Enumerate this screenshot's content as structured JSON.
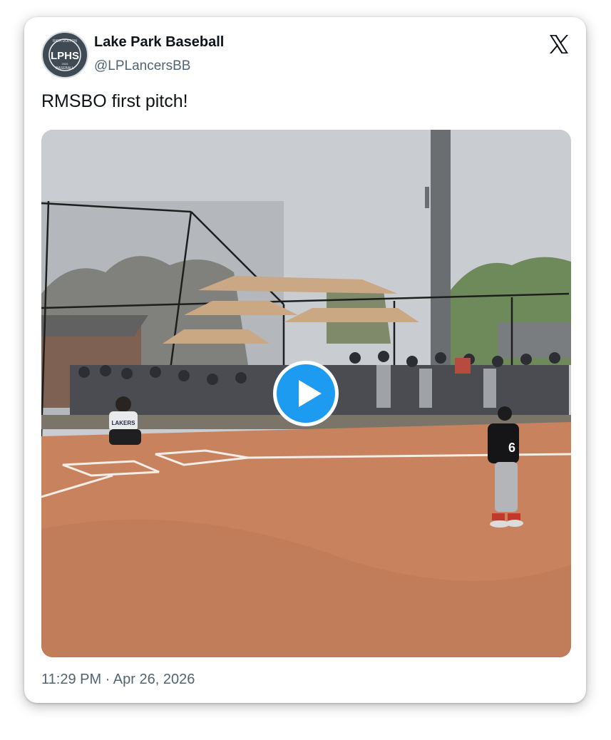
{
  "tweet": {
    "author_name": "Lake Park Baseball",
    "author_handle": "@LPLancersBB",
    "text": "RMSBO first pitch!",
    "timestamp": "11:29 PM · Apr 26, 2026",
    "avatar": {
      "monogram": "LPHS",
      "ring_text_top": "RICH DOLTON",
      "ring_text_bottom": "BASEBALL",
      "year": "2025"
    }
  },
  "media": {
    "type": "video",
    "player_number": "6",
    "jersey_text": "LAKERS"
  },
  "icons": {
    "close": "x-logo-icon",
    "play": "play-icon"
  },
  "colors": {
    "play_button": "#1d9bf0",
    "dirt": "#c8835e",
    "sky": "#c9cdd2"
  }
}
